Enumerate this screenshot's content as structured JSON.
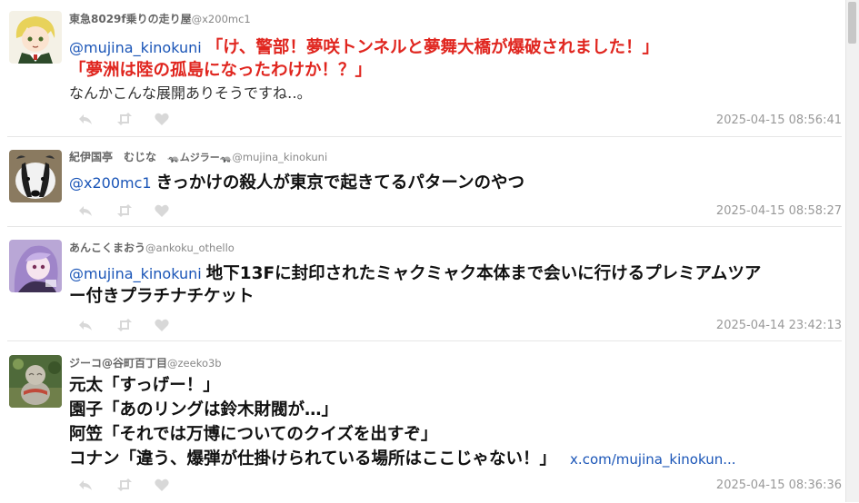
{
  "tweets": [
    {
      "name": "東急8029f乗りの走り屋",
      "handle": "@x200mc1",
      "mention": "@mujina_kinokuni",
      "line1": "「け、警部！夢咲トンネルと夢舞大橋が爆破されました！」",
      "line2": "「夢洲は陸の孤島になったわけか！？」",
      "line3": "なんかこんな展開ありそうですね‥。",
      "time": "2025-04-15 08:56:41"
    },
    {
      "name": "紀伊国亭　むじな　",
      "name_badge": "🦡ムジラー🦡",
      "handle": "@mujina_kinokuni",
      "mention": "@x200mc1",
      "line1": "きっかけの殺人が東京で起きてるパターンのやつ",
      "time": "2025-04-15 08:58:27"
    },
    {
      "name": "あんこくまおう",
      "handle": "@ankoku_othello",
      "mention": "@mujina_kinokuni",
      "line1": "地下13Fに封印されたミャクミャク本体まで会いに行けるプレミアムツア",
      "line2": "ー付きプラチナチケット",
      "time": "2025-04-14 23:42:13"
    },
    {
      "name": "ジーコ@谷町百丁目",
      "handle": "@zeeko3b",
      "line1": "元太「すっげー！」",
      "line2": "園子「あのリングは鈴木財閥が…」",
      "line3": "阿笠「それでは万博についてのクイズを出すぞ」",
      "line4": "コナン「違う、爆弾が仕掛けられている場所はここじゃない！」",
      "link": "x.com/mujina_kinokun...",
      "time": "2025-04-15 08:36:36"
    }
  ],
  "icons": [
    "reply-icon",
    "retweet-icon",
    "like-icon"
  ],
  "colors": {
    "mention": "#1a55b7",
    "red_text": "#e0261f",
    "meta": "#999999"
  }
}
